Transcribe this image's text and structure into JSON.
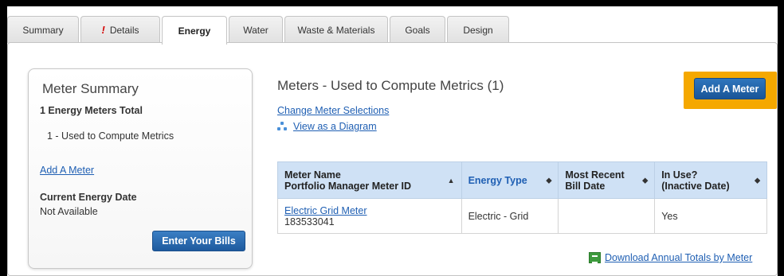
{
  "tabs": [
    {
      "label": "Summary",
      "alert": false
    },
    {
      "label": "Details",
      "alert": true,
      "alert_glyph": "!"
    },
    {
      "label": "Energy",
      "active": true
    },
    {
      "label": "Water"
    },
    {
      "label": "Waste & Materials"
    },
    {
      "label": "Goals"
    },
    {
      "label": "Design"
    }
  ],
  "meter_summary": {
    "title": "Meter Summary",
    "total": "1 Energy Meters Total",
    "used": "1 - Used to Compute Metrics",
    "add_link": "Add A Meter",
    "current_date_label": "Current Energy Date",
    "current_date_value": "Not Available",
    "enter_bills": "Enter Your Bills"
  },
  "meters": {
    "title": "Meters - Used to Compute Metrics (1)",
    "change_link": "Change Meter Selections",
    "diagram_link": "View as a Diagram",
    "add_button": "Add A Meter",
    "columns": {
      "name_line1": "Meter Name",
      "name_line2": "Portfolio Manager Meter ID",
      "energy_type": "Energy Type",
      "recent_bill_line1": "Most Recent",
      "recent_bill_line2": "Bill Date",
      "in_use_line1": "In Use?",
      "in_use_line2": "(Inactive Date)"
    },
    "rows": [
      {
        "name": "Electric Grid Meter",
        "id": "183533041",
        "energy_type": "Electric - Grid",
        "recent_bill": "",
        "in_use": "Yes"
      }
    ],
    "download_link": "Download Annual Totals by Meter"
  },
  "colors": {
    "highlight": "#f5a800",
    "button": "#1e5a9e",
    "link": "#1f5fb3",
    "header_bg": "#cfe1f5"
  }
}
